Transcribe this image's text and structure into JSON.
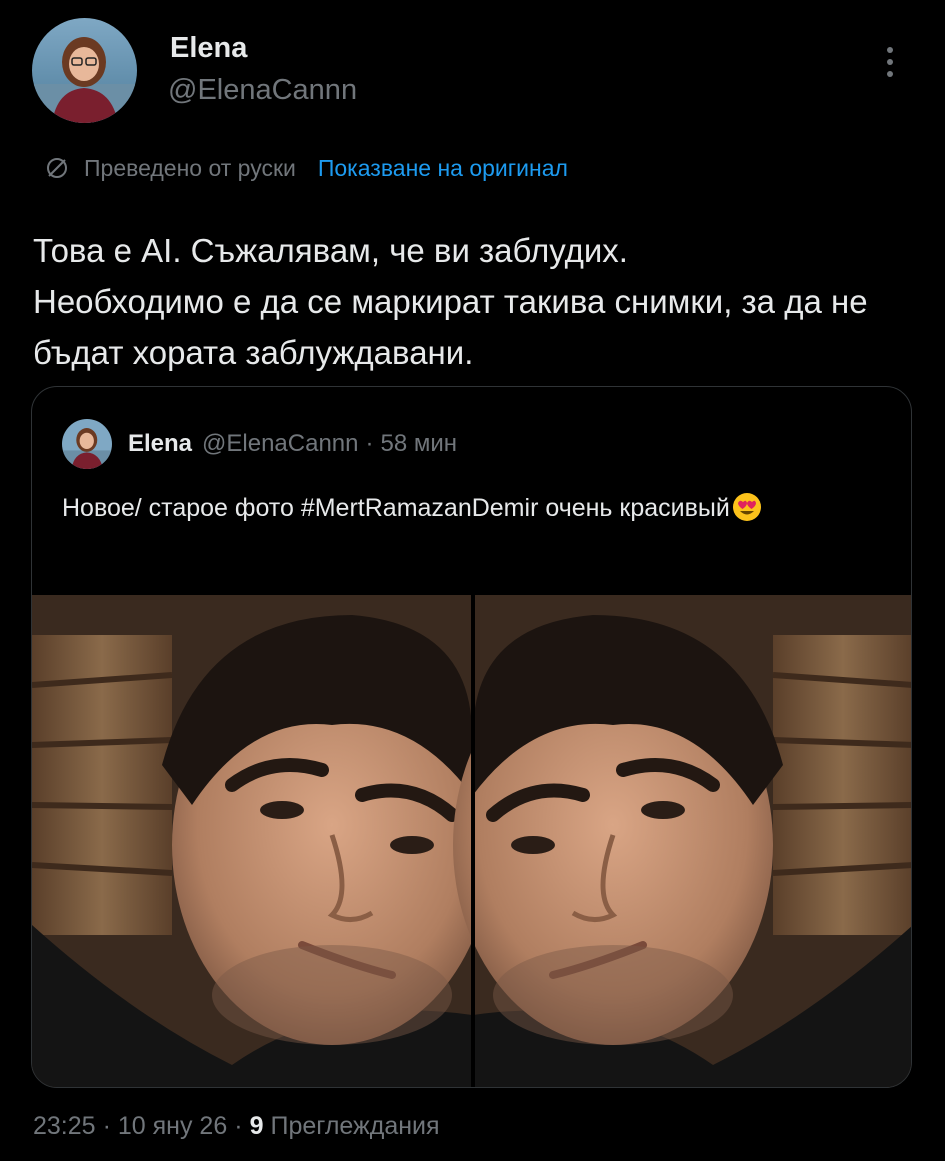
{
  "author": {
    "display_name": "Elena",
    "handle": "@ElenaCannn"
  },
  "menu_icon": "more-vertical-icon",
  "translation": {
    "icon": "translate-icon",
    "label": "Преведено от руски",
    "show_original": "Показване на оригинал"
  },
  "tweet": {
    "lines": [
      "Това е AI. Съжалявам, че ви заблудих.",
      "Необходимо е да се маркират такива снимки, за да не бъдат хората заблуждавани."
    ]
  },
  "quote": {
    "display_name": "Elena",
    "handle": "@ElenaCannn",
    "time": "58 мин",
    "text": "Новое/ старое фото #MertRamazanDemir очень красивый",
    "emoji": "smiling-face-with-heart-eyes-icon",
    "media": "mirrored-portrait-photo"
  },
  "footer": {
    "time": "23:25",
    "date": "10 яну 26",
    "views_count": "9",
    "views_label": "Преглеждания"
  },
  "colors": {
    "background": "#000000",
    "text": "#e7e9ea",
    "muted": "#71767b",
    "link": "#1d9bf0",
    "border": "#2f3336"
  }
}
